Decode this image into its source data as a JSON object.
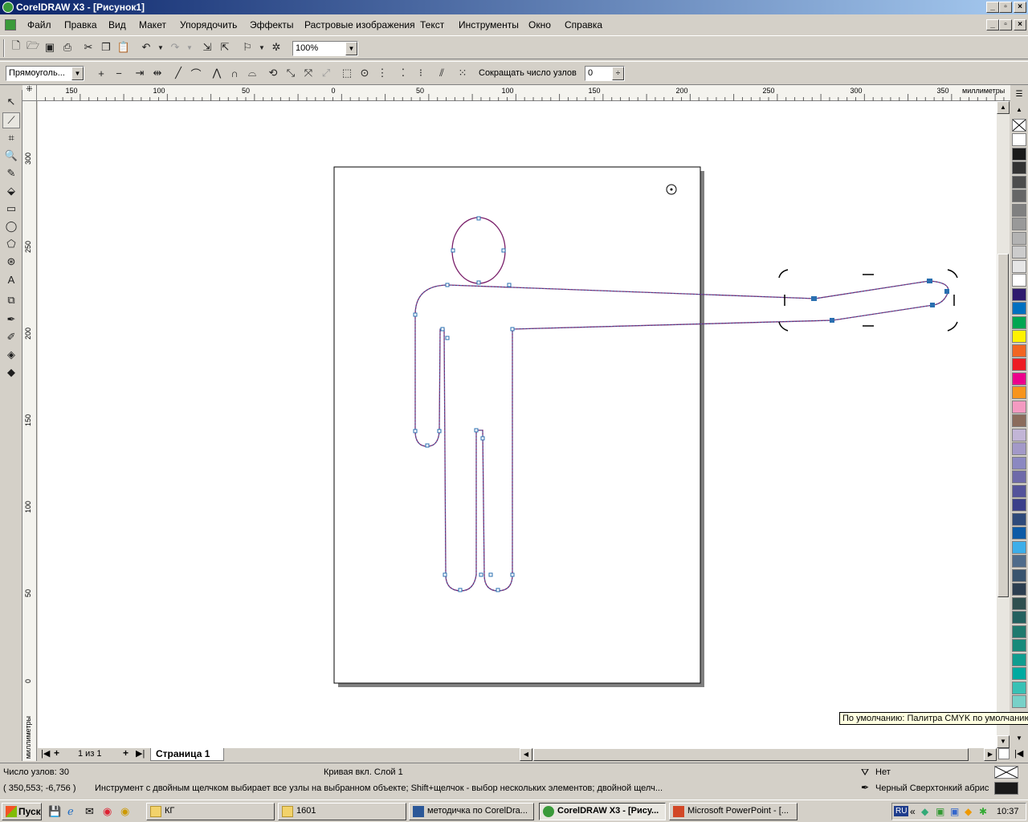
{
  "window": {
    "title": "CorelDRAW X3 - [Рисунок1]"
  },
  "menu": [
    "Файл",
    "Правка",
    "Вид",
    "Макет",
    "Упорядочить",
    "Эффекты",
    "Растровые изображения",
    "Текст",
    "Инструменты",
    "Окно",
    "Справка"
  ],
  "toolbar": {
    "zoom_value": "100%"
  },
  "propertybar": {
    "selection_mode": "Прямоуголь...",
    "reduce_nodes_label": "Сокращать число узлов",
    "reduce_nodes_value": "0"
  },
  "ruler": {
    "units": "миллиметры",
    "h_ticks": [
      "150",
      "100",
      "50",
      "0",
      "50",
      "100",
      "150",
      "200",
      "250",
      "300",
      "350"
    ],
    "v_ticks": [
      "300",
      "250",
      "200",
      "150",
      "100",
      "50",
      "0"
    ]
  },
  "pages": {
    "counter": "1 из 1",
    "tab": "Страница 1"
  },
  "tooltip": "По умолчанию: Палитра CMYK по умолчанию",
  "status": {
    "node_count": "Число узлов: 30",
    "object_info": "Кривая вкл. Слой 1",
    "fill_label": "Нет",
    "outline_label": "Черный  Сверхтонкий абрис",
    "coordinates": "( 350,553; -6,756 )",
    "hint": "Инструмент с двойным щелчком выбирает все узлы на выбранном объекте; Shift+щелчок - выбор нескольких элементов; двойной щелч..."
  },
  "palette_colors": [
    "#ffffff",
    "#1a1a1a",
    "#333333",
    "#4d4d4d",
    "#666666",
    "#808080",
    "#999999",
    "#b3b3b3",
    "#cccccc",
    "#e6e6e6",
    "#ffffff",
    "#2e1a6e",
    "#0070c0",
    "#00a651",
    "#fff200",
    "#f26522",
    "#ed1c24",
    "#ec008c",
    "#f7941d",
    "#f49ac1",
    "#8b6c5c",
    "#c2b5d6",
    "#a399c8",
    "#8b88c1",
    "#6f6aa9",
    "#54539a",
    "#3b3f8a",
    "#2e4a7a",
    "#0c5aa6",
    "#3daee9",
    "#4f6b8a",
    "#39546e",
    "#2c3e50",
    "#2f4f4f",
    "#24615f",
    "#1f7a6e",
    "#178a7a",
    "#0f9d8f",
    "#00aaa0",
    "#38c1b5",
    "#78d1c8"
  ],
  "taskbar": {
    "start": "Пуск",
    "tasks": [
      "КГ",
      "1601",
      "методичка по CorelDra...",
      "CorelDRAW X3 - [Рису...",
      "Microsoft PowerPoint - [..."
    ],
    "lang": "RU",
    "clock": "10:37"
  }
}
